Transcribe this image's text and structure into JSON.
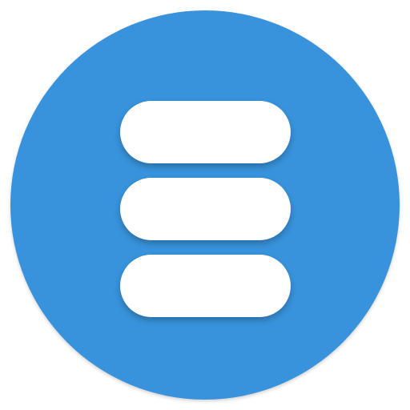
{
  "app_icon": {
    "icon": "stacked-list-menu-icon",
    "colors": {
      "circle": "#3893DC",
      "bars": "#FFFFFF",
      "background": "#FFFFFF"
    },
    "bar_count": 3
  }
}
